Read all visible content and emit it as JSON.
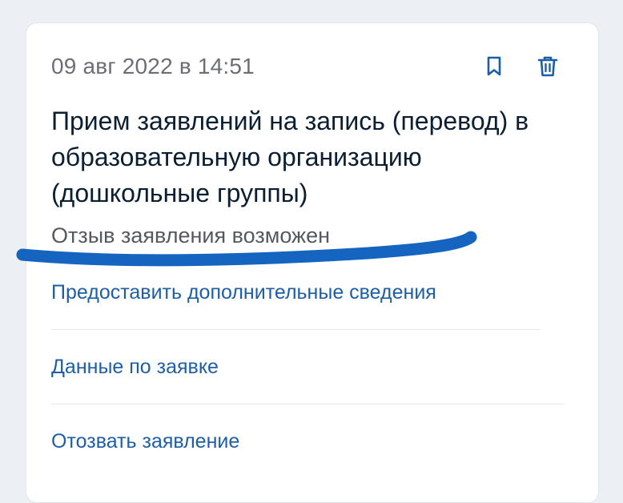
{
  "card": {
    "date": "09 авг 2022 в 14:51",
    "title": "Прием заявлений на запись (перевод) в образовательную организацию (дошкольные группы)",
    "status": "Отзыв заявления возможен",
    "icons": {
      "bookmark": "bookmark-icon",
      "delete": "trash-icon"
    },
    "links": [
      "Предоставить дополнительные сведения",
      "Данные по заявке",
      "Отозвать заявление"
    ]
  },
  "colors": {
    "accent": "#1d5ea8",
    "title_text": "#0b1f33",
    "secondary_text": "#6b6f75",
    "highlight_stroke": "#1565c0"
  }
}
